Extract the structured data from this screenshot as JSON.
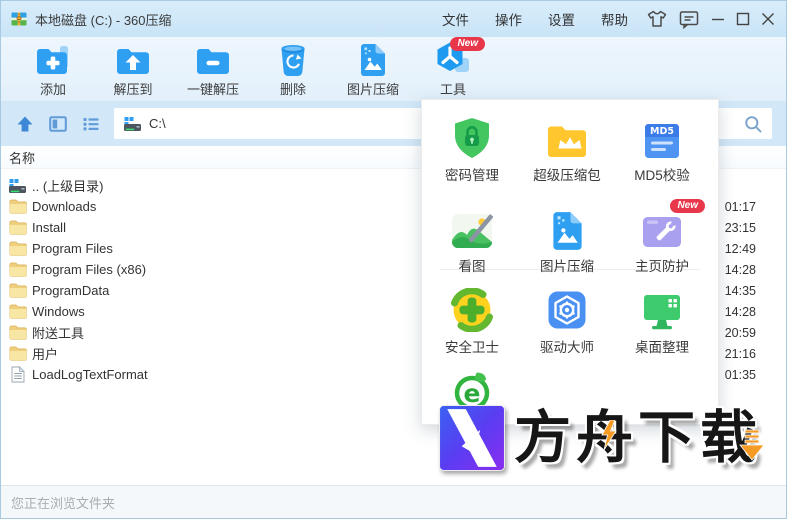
{
  "window": {
    "title": "本地磁盘 (C:) - 360压缩"
  },
  "titlebar": {
    "menu_items": [
      {
        "label": "文件",
        "name": "file"
      },
      {
        "label": "操作",
        "name": "operation"
      },
      {
        "label": "设置",
        "name": "settings"
      },
      {
        "label": "帮助",
        "name": "help"
      }
    ]
  },
  "toolbar": {
    "buttons": [
      {
        "label": "添加",
        "name": "add",
        "icon": "folder-add-icon"
      },
      {
        "label": "解压到",
        "name": "extract-to",
        "icon": "folder-extract-icon"
      },
      {
        "label": "一键解压",
        "name": "one-click-extract",
        "icon": "folder-oneclick-icon"
      },
      {
        "label": "删除",
        "name": "delete",
        "icon": "trash-icon"
      },
      {
        "label": "图片压缩",
        "name": "image-compress",
        "icon": "image-compress-icon"
      },
      {
        "label": "工具",
        "name": "tools",
        "icon": "tools-cube-icon",
        "badge": "New"
      }
    ]
  },
  "addressbar": {
    "path": "C:\\"
  },
  "file_list": {
    "header": "名称",
    "rows": [
      {
        "name": ".. (上级目录)",
        "icon": "drive-icon",
        "time": ""
      },
      {
        "name": "Downloads",
        "icon": "folder-icon",
        "time": "01:17"
      },
      {
        "name": "Install",
        "icon": "folder-icon",
        "time": "23:15"
      },
      {
        "name": "Program Files",
        "icon": "folder-icon",
        "time": "12:49"
      },
      {
        "name": "Program Files (x86)",
        "icon": "folder-icon",
        "time": "14:28"
      },
      {
        "name": "ProgramData",
        "icon": "folder-icon",
        "time": "14:35"
      },
      {
        "name": "Windows",
        "icon": "folder-icon",
        "time": "14:28"
      },
      {
        "name": "附送工具",
        "icon": "folder-icon",
        "time": "20:59"
      },
      {
        "name": "用户",
        "icon": "folder-icon",
        "time": "21:16"
      },
      {
        "name": "LoadLogTextFormat",
        "icon": "document-icon",
        "time": "01:35"
      }
    ]
  },
  "tools_popup": {
    "rows": [
      [
        {
          "label": "密码管理",
          "name": "password-manager",
          "icon": "password-shield-icon"
        },
        {
          "label": "超级压缩包",
          "name": "super-archive",
          "icon": "super-archive-icon"
        },
        {
          "label": "MD5校验",
          "name": "md5-check",
          "icon": "md5-icon"
        }
      ],
      [
        {
          "label": "看图",
          "name": "image-viewer",
          "icon": "image-viewer-icon"
        },
        {
          "label": "图片压缩",
          "name": "image-compress",
          "icon": "image-compress-lg-icon"
        },
        {
          "label": "主页防护",
          "name": "homepage-guard",
          "icon": "homepage-guard-icon",
          "badge": "New"
        }
      ],
      [
        {
          "label": "安全卫士",
          "name": "safety-guard",
          "icon": "safety-guard-icon"
        },
        {
          "label": "驱动大师",
          "name": "driver-master",
          "icon": "driver-master-icon"
        },
        {
          "label": "桌面整理",
          "name": "desktop-organize",
          "icon": "desktop-organize-icon"
        }
      ],
      [
        {
          "label": "",
          "name": "browser",
          "icon": "browser-e-icon"
        }
      ]
    ]
  },
  "icons": {
    "md5_text": "MD5"
  },
  "watermark": {
    "text": "方舟下载"
  },
  "statusbar": {
    "text": "您正在浏览文件夹"
  },
  "colors": {
    "accent_blue": "#2f9ff2",
    "badge_red": "#e8374a",
    "titlebar_bg": "#cfe7f8",
    "toolbar_bg": "#e9f4fc",
    "address_bg": "#d2e8f8",
    "folder_yellow": "#f8e6a4",
    "status_text": "#a7adb3"
  }
}
